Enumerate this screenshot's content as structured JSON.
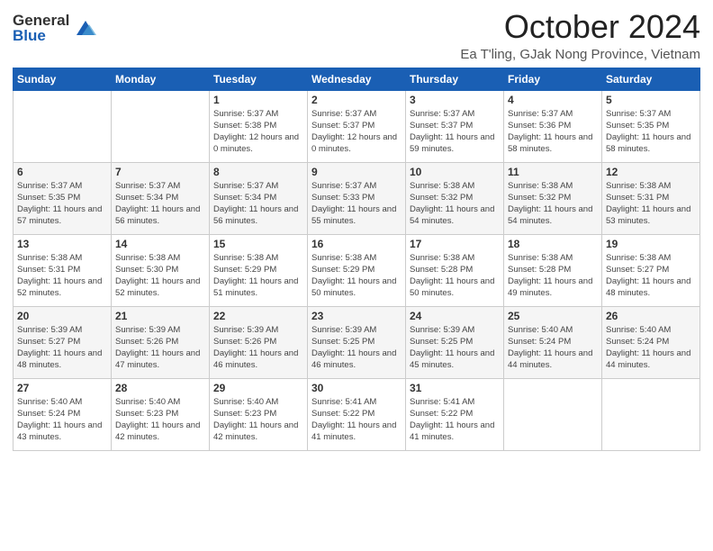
{
  "header": {
    "logo_general": "General",
    "logo_blue": "Blue",
    "month_title": "October 2024",
    "location": "Ea T'ling, GJak Nong Province, Vietnam"
  },
  "days_of_week": [
    "Sunday",
    "Monday",
    "Tuesday",
    "Wednesday",
    "Thursday",
    "Friday",
    "Saturday"
  ],
  "weeks": [
    [
      {
        "day": "",
        "sunrise": "",
        "sunset": "",
        "daylight": ""
      },
      {
        "day": "",
        "sunrise": "",
        "sunset": "",
        "daylight": ""
      },
      {
        "day": "1",
        "sunrise": "Sunrise: 5:37 AM",
        "sunset": "Sunset: 5:38 PM",
        "daylight": "Daylight: 12 hours and 0 minutes."
      },
      {
        "day": "2",
        "sunrise": "Sunrise: 5:37 AM",
        "sunset": "Sunset: 5:37 PM",
        "daylight": "Daylight: 12 hours and 0 minutes."
      },
      {
        "day": "3",
        "sunrise": "Sunrise: 5:37 AM",
        "sunset": "Sunset: 5:37 PM",
        "daylight": "Daylight: 11 hours and 59 minutes."
      },
      {
        "day": "4",
        "sunrise": "Sunrise: 5:37 AM",
        "sunset": "Sunset: 5:36 PM",
        "daylight": "Daylight: 11 hours and 58 minutes."
      },
      {
        "day": "5",
        "sunrise": "Sunrise: 5:37 AM",
        "sunset": "Sunset: 5:35 PM",
        "daylight": "Daylight: 11 hours and 58 minutes."
      }
    ],
    [
      {
        "day": "6",
        "sunrise": "Sunrise: 5:37 AM",
        "sunset": "Sunset: 5:35 PM",
        "daylight": "Daylight: 11 hours and 57 minutes."
      },
      {
        "day": "7",
        "sunrise": "Sunrise: 5:37 AM",
        "sunset": "Sunset: 5:34 PM",
        "daylight": "Daylight: 11 hours and 56 minutes."
      },
      {
        "day": "8",
        "sunrise": "Sunrise: 5:37 AM",
        "sunset": "Sunset: 5:34 PM",
        "daylight": "Daylight: 11 hours and 56 minutes."
      },
      {
        "day": "9",
        "sunrise": "Sunrise: 5:37 AM",
        "sunset": "Sunset: 5:33 PM",
        "daylight": "Daylight: 11 hours and 55 minutes."
      },
      {
        "day": "10",
        "sunrise": "Sunrise: 5:38 AM",
        "sunset": "Sunset: 5:32 PM",
        "daylight": "Daylight: 11 hours and 54 minutes."
      },
      {
        "day": "11",
        "sunrise": "Sunrise: 5:38 AM",
        "sunset": "Sunset: 5:32 PM",
        "daylight": "Daylight: 11 hours and 54 minutes."
      },
      {
        "day": "12",
        "sunrise": "Sunrise: 5:38 AM",
        "sunset": "Sunset: 5:31 PM",
        "daylight": "Daylight: 11 hours and 53 minutes."
      }
    ],
    [
      {
        "day": "13",
        "sunrise": "Sunrise: 5:38 AM",
        "sunset": "Sunset: 5:31 PM",
        "daylight": "Daylight: 11 hours and 52 minutes."
      },
      {
        "day": "14",
        "sunrise": "Sunrise: 5:38 AM",
        "sunset": "Sunset: 5:30 PM",
        "daylight": "Daylight: 11 hours and 52 minutes."
      },
      {
        "day": "15",
        "sunrise": "Sunrise: 5:38 AM",
        "sunset": "Sunset: 5:29 PM",
        "daylight": "Daylight: 11 hours and 51 minutes."
      },
      {
        "day": "16",
        "sunrise": "Sunrise: 5:38 AM",
        "sunset": "Sunset: 5:29 PM",
        "daylight": "Daylight: 11 hours and 50 minutes."
      },
      {
        "day": "17",
        "sunrise": "Sunrise: 5:38 AM",
        "sunset": "Sunset: 5:28 PM",
        "daylight": "Daylight: 11 hours and 50 minutes."
      },
      {
        "day": "18",
        "sunrise": "Sunrise: 5:38 AM",
        "sunset": "Sunset: 5:28 PM",
        "daylight": "Daylight: 11 hours and 49 minutes."
      },
      {
        "day": "19",
        "sunrise": "Sunrise: 5:38 AM",
        "sunset": "Sunset: 5:27 PM",
        "daylight": "Daylight: 11 hours and 48 minutes."
      }
    ],
    [
      {
        "day": "20",
        "sunrise": "Sunrise: 5:39 AM",
        "sunset": "Sunset: 5:27 PM",
        "daylight": "Daylight: 11 hours and 48 minutes."
      },
      {
        "day": "21",
        "sunrise": "Sunrise: 5:39 AM",
        "sunset": "Sunset: 5:26 PM",
        "daylight": "Daylight: 11 hours and 47 minutes."
      },
      {
        "day": "22",
        "sunrise": "Sunrise: 5:39 AM",
        "sunset": "Sunset: 5:26 PM",
        "daylight": "Daylight: 11 hours and 46 minutes."
      },
      {
        "day": "23",
        "sunrise": "Sunrise: 5:39 AM",
        "sunset": "Sunset: 5:25 PM",
        "daylight": "Daylight: 11 hours and 46 minutes."
      },
      {
        "day": "24",
        "sunrise": "Sunrise: 5:39 AM",
        "sunset": "Sunset: 5:25 PM",
        "daylight": "Daylight: 11 hours and 45 minutes."
      },
      {
        "day": "25",
        "sunrise": "Sunrise: 5:40 AM",
        "sunset": "Sunset: 5:24 PM",
        "daylight": "Daylight: 11 hours and 44 minutes."
      },
      {
        "day": "26",
        "sunrise": "Sunrise: 5:40 AM",
        "sunset": "Sunset: 5:24 PM",
        "daylight": "Daylight: 11 hours and 44 minutes."
      }
    ],
    [
      {
        "day": "27",
        "sunrise": "Sunrise: 5:40 AM",
        "sunset": "Sunset: 5:24 PM",
        "daylight": "Daylight: 11 hours and 43 minutes."
      },
      {
        "day": "28",
        "sunrise": "Sunrise: 5:40 AM",
        "sunset": "Sunset: 5:23 PM",
        "daylight": "Daylight: 11 hours and 42 minutes."
      },
      {
        "day": "29",
        "sunrise": "Sunrise: 5:40 AM",
        "sunset": "Sunset: 5:23 PM",
        "daylight": "Daylight: 11 hours and 42 minutes."
      },
      {
        "day": "30",
        "sunrise": "Sunrise: 5:41 AM",
        "sunset": "Sunset: 5:22 PM",
        "daylight": "Daylight: 11 hours and 41 minutes."
      },
      {
        "day": "31",
        "sunrise": "Sunrise: 5:41 AM",
        "sunset": "Sunset: 5:22 PM",
        "daylight": "Daylight: 11 hours and 41 minutes."
      },
      {
        "day": "",
        "sunrise": "",
        "sunset": "",
        "daylight": ""
      },
      {
        "day": "",
        "sunrise": "",
        "sunset": "",
        "daylight": ""
      }
    ]
  ]
}
